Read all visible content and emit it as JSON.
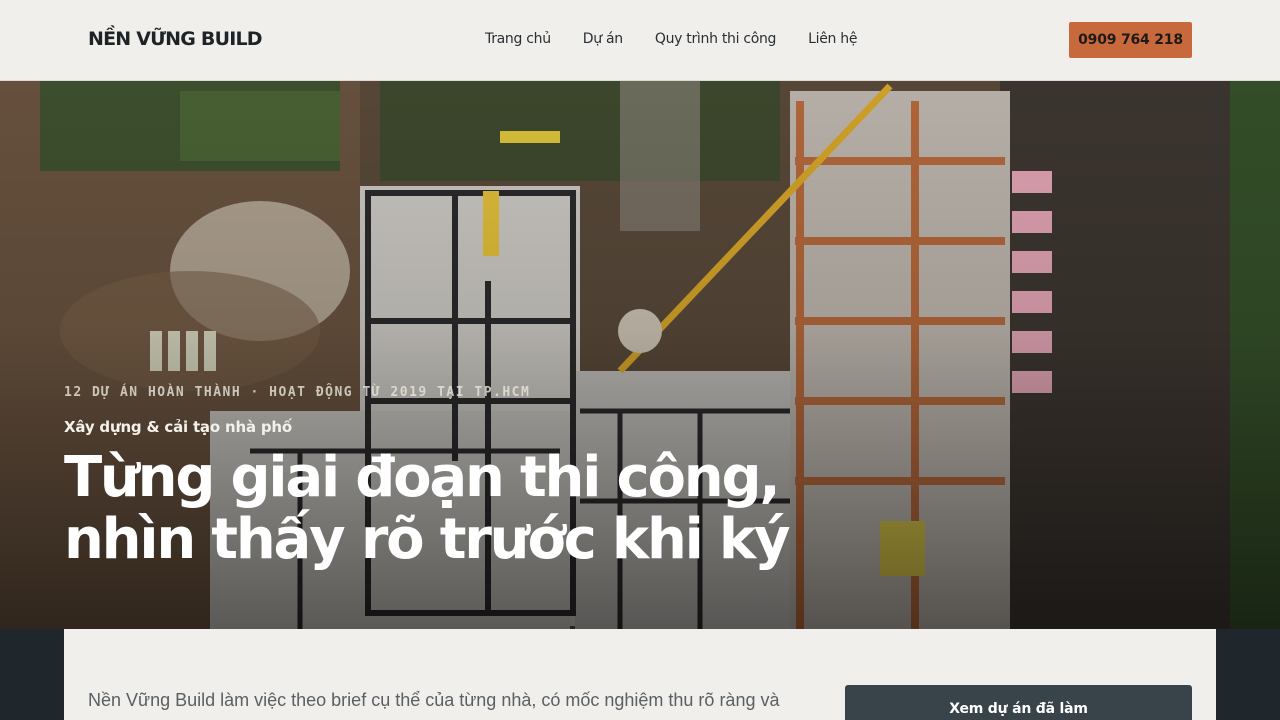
{
  "header": {
    "logo": "NỀN VỮNG BUILD",
    "nav": [
      "Trang chủ",
      "Dự án",
      "Quy trình thi công",
      "Liên hệ"
    ],
    "phone": "0909 764 218"
  },
  "hero": {
    "eyebrow": "12 DỰ ÁN HOÀN THÀNH · HOẠT ĐỘNG TỪ 2019 TẠI TP.HCM",
    "subtitle": "Xây dựng & cải tạo nhà phố",
    "headline_line1": "Từng giai đoạn thi công,",
    "headline_line2": "nhìn thấy rõ trước khi ký"
  },
  "intro": {
    "text": "Nền Vững Build làm việc theo brief cụ thể của từng nhà, có mốc nghiệm thu rõ ràng và",
    "cta": "Xem dự án đã làm"
  },
  "colors": {
    "accent": "#c8693d",
    "header_bg": "#f0efeb",
    "dark": "#1f262c",
    "cta_bg": "#39434a"
  }
}
